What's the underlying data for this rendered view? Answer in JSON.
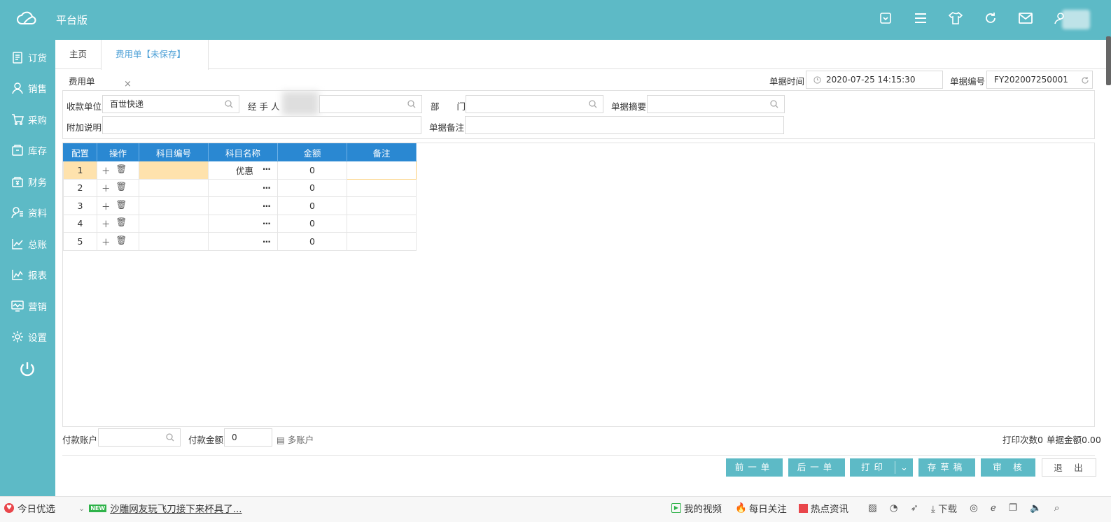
{
  "header": {
    "brand": "平台版",
    "icons": [
      "dashboard-icon",
      "menu-icon",
      "shirt-icon",
      "refresh-icon",
      "mail-icon",
      "user-icon"
    ]
  },
  "sidebar": {
    "items": [
      {
        "label": "订货",
        "icon": "order-icon"
      },
      {
        "label": "销售",
        "icon": "sales-icon"
      },
      {
        "label": "采购",
        "icon": "cart-icon"
      },
      {
        "label": "库存",
        "icon": "inventory-icon"
      },
      {
        "label": "财务",
        "icon": "finance-icon"
      },
      {
        "label": "资料",
        "icon": "profile-icon"
      },
      {
        "label": "总账",
        "icon": "ledger-icon"
      },
      {
        "label": "报表",
        "icon": "report-icon"
      },
      {
        "label": "营销",
        "icon": "marketing-icon"
      },
      {
        "label": "设置",
        "icon": "settings-icon"
      }
    ]
  },
  "tabs": [
    {
      "label": "主页"
    },
    {
      "label": "费用单【未保存】",
      "close": "×"
    }
  ],
  "form": {
    "title": "费用单",
    "doc_time_label": "单据时间",
    "doc_time_value": "2020-07-25 14:15:30",
    "doc_no_label": "单据编号",
    "doc_no_value": "FY202007250001",
    "payee_label": "收款单位",
    "payee_value": "百世快递",
    "handler_label": "经 手 人",
    "dept_label": "部　　门",
    "summary_label": "单据摘要",
    "note_label": "附加说明",
    "remark_label": "单据备注"
  },
  "table": {
    "columns": [
      "配置",
      "操作",
      "科目编号",
      "科目名称",
      "金额",
      "备注"
    ],
    "rows": [
      {
        "no": "1",
        "name": "优惠",
        "amount": "0"
      },
      {
        "no": "2",
        "name": "",
        "amount": "0"
      },
      {
        "no": "3",
        "name": "",
        "amount": "0"
      },
      {
        "no": "4",
        "name": "",
        "amount": "0"
      },
      {
        "no": "5",
        "name": "",
        "amount": "0"
      }
    ],
    "dots": "···"
  },
  "footer": {
    "pay_account_label": "付款账户",
    "pay_amount_label": "付款金额",
    "pay_amount_value": "0",
    "multi_account": "多账户",
    "print_count": "打印次数0",
    "doc_amount": "单据金额0.00"
  },
  "buttons": {
    "prev": "前一单",
    "next": "后一单",
    "print": "打印",
    "draft": "存草稿",
    "audit": "审　核",
    "exit": "退　出"
  },
  "statusbar": {
    "today": "今日优选",
    "new_badge": "NEW",
    "news": "沙雕网友玩飞刀接下来杯具了...",
    "video": "我的视频",
    "follow": "每日关注",
    "hot": "热点资讯",
    "download": "下载"
  }
}
